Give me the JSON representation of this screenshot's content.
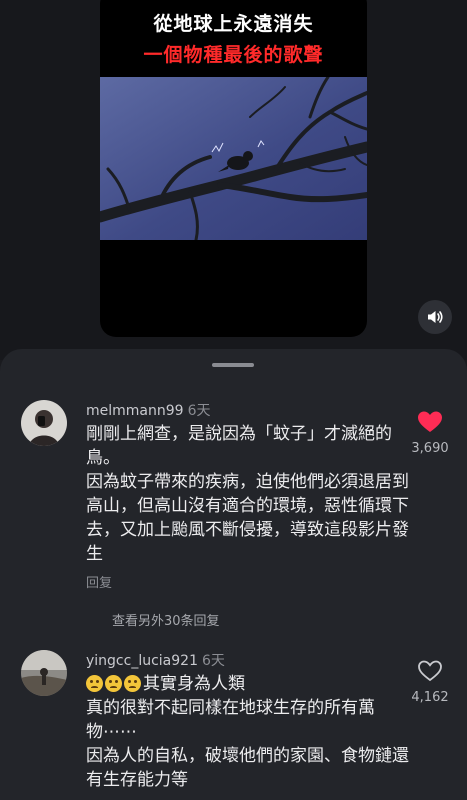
{
  "video": {
    "caption_line1": "從地球上永遠消失",
    "caption_line2": "一個物種最後的歌聲",
    "caption_line1_color": "#ffffff",
    "caption_line2_color": "#ff2a2a",
    "mute_icon": "speaker-icon"
  },
  "comments": [
    {
      "username": "melmmann99",
      "time": "6天",
      "lines": [
        "剛剛上網查，是說因為「蚊子」才滅絕的鳥。",
        "因為蚊子帶來的疾病，迫使他們必須退居到高山，但高山沒有適合的環境，惡性循環下去，又加上颱風不斷侵擾，導致這段影片發生"
      ],
      "reply_label": "回复",
      "likes": "3,690",
      "liked": true,
      "more_replies": "查看另外30条回复"
    },
    {
      "username": "yingcc_lucia921",
      "time": "6天",
      "emoji_count": 3,
      "lines": [
        "其實身為人類",
        "真的很對不起同樣在地球生存的所有萬物⋯⋯",
        "因為人的自私，破壞他們的家園、食物鏈還有生存能力等"
      ],
      "likes": "4,162",
      "liked": false
    }
  ],
  "colors": {
    "like_active": "#fe2c55",
    "sheet_bg": "#23252a",
    "page_bg": "#1a1b1f"
  }
}
